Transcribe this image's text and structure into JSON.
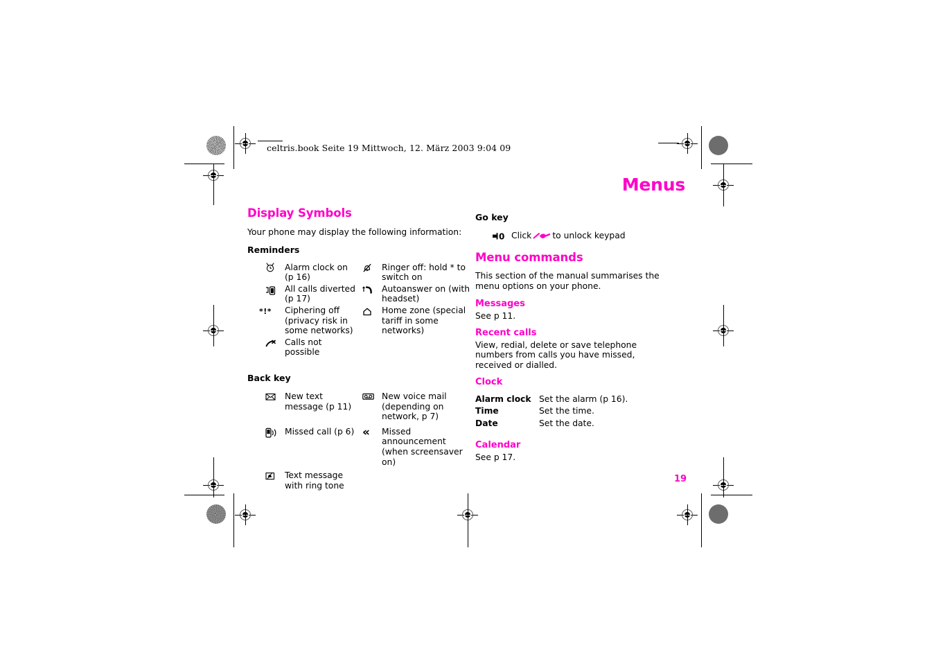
{
  "document": {
    "header_line": "celtris.book  Seite 19  Mittwoch, 12. März 2003  9:04 09",
    "running_head": "Menus",
    "page_number": "19",
    "accent_color": "#ff00c8"
  },
  "left_column": {
    "section_title": "Display Symbols",
    "intro": "Your phone may display the following information:",
    "reminders": {
      "heading": "Reminders",
      "rows": [
        {
          "left_icon": "alarm-clock-icon",
          "left_text": " Alarm clock on (p 16)",
          "right_icon": "ringer-off-icon",
          "right_text": "Ringer off: hold * to switch on"
        },
        {
          "left_icon": "call-divert-icon",
          "left_text": "All calls diverted (p 17)",
          "right_icon": "autoanswer-icon",
          "right_text": "Autoanswer on (with headset)"
        },
        {
          "left_icon": "ciphering-off-icon",
          "left_text": "Ciphering off (privacy risk in some networks)",
          "right_icon": "home-zone-icon",
          "right_text": "Home zone (special tariff in some networks)"
        },
        {
          "left_icon": "calls-not-possible-icon",
          "left_text": "Calls not possible",
          "right_icon": "",
          "right_text": ""
        }
      ]
    },
    "back_key": {
      "heading": "Back key",
      "rows": [
        {
          "left_icon": "envelope-icon",
          "left_text": "New text message (p 11)",
          "right_icon": "voice-mail-icon",
          "right_text": "New voice mail (depending on network, p 7)"
        },
        {
          "left_icon": "missed-call-icon",
          "left_text": " Missed call (p 6)",
          "right_icon": "missed-announcement-icon",
          "right_text": "Missed announcement (when screensaver on)"
        },
        {
          "left_icon": "text-message-ringtone-icon",
          "left_text": "Text message with ring tone",
          "right_icon": "",
          "right_text": ""
        }
      ]
    }
  },
  "right_column": {
    "go_key": {
      "heading": "Go key",
      "icon": "go-key-zero-icon",
      "text_before": "Click",
      "text_after": "to unlock keypad",
      "inline_icon": "key-icon"
    },
    "menu_commands": {
      "section_title": "Menu commands",
      "intro": "This section of the manual summarises the menu options on your phone.",
      "groups": [
        {
          "title": "Messages",
          "body": "See p 11."
        },
        {
          "title": "Recent calls",
          "body": "View, redial, delete or save telephone numbers from calls you have missed, received or dialled."
        },
        {
          "title": "Clock",
          "body": "",
          "table": [
            {
              "key": "Alarm clock",
              "value": "Set the alarm (p 16)."
            },
            {
              "key": "Time",
              "value": "Set the time."
            },
            {
              "key": "Date",
              "value": "Set the date."
            }
          ]
        },
        {
          "title": "Calendar",
          "body": "See p 17."
        }
      ]
    }
  }
}
